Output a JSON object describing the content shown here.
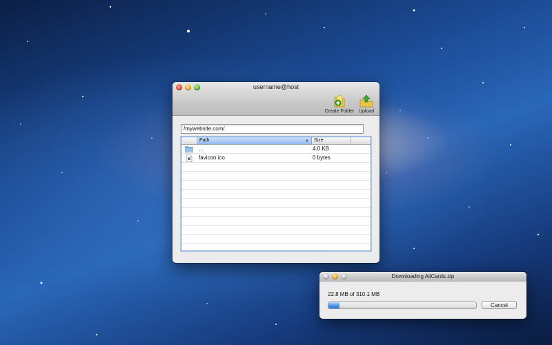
{
  "main_window": {
    "title": "username@host",
    "toolbar": {
      "create_folder_label": "Create Folder",
      "upload_label": "Upload"
    },
    "path_field_value": "/mywebsite.com/",
    "table": {
      "columns": [
        "Path",
        "Size"
      ],
      "rows": [
        {
          "icon": "folder-icon",
          "path": "..",
          "size": "4.0 KB"
        },
        {
          "icon": "file-icon",
          "path": "favicon.ico",
          "size": "0 bytes"
        }
      ]
    }
  },
  "download_window": {
    "title": "Downloading AllCards.zip",
    "status": "22.8 MB of 310.1 MB",
    "progress_fraction": 0.0735,
    "cancel_label": "Cancel"
  },
  "colors": {
    "selected_header": "#8fb7ee",
    "progress_fill": "#2f7ad8"
  }
}
